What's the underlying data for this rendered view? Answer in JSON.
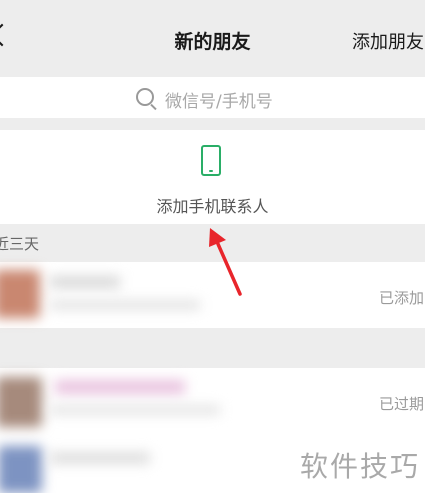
{
  "header": {
    "title": "新的朋友",
    "action_label": "添加朋友"
  },
  "search": {
    "placeholder": "微信号/手机号"
  },
  "contacts": {
    "label": "添加手机联系人"
  },
  "section": {
    "label": "近三天"
  },
  "friends": [
    {
      "status": "已添加"
    },
    {
      "status": "已过期"
    }
  ],
  "watermark": "软件技巧",
  "colors": {
    "accent": "#2aae67",
    "annotation_arrow": "#e8252b",
    "background": "#ededed"
  }
}
